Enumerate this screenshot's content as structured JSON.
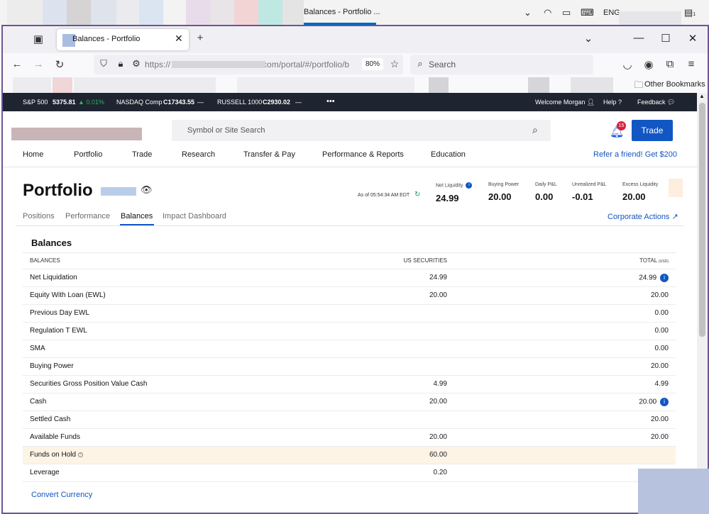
{
  "taskbar": {
    "title": "Balances - Portfolio ...",
    "tray_lang": "ENG",
    "notification_count": "1"
  },
  "browser": {
    "tab_title": "Balances - Portfolio",
    "url": "https://",
    "url_tail": "com/portal/#/portfolio/b",
    "zoom": "80%",
    "search_placeholder": "Search",
    "bookmarks_label": "Other Bookmarks"
  },
  "ticker": {
    "sp500_label": "S&P 500",
    "sp500_value": "5375.81",
    "sp500_change": "▲ 0.01%",
    "nasdaq_label": "NASDAQ Comp",
    "nasdaq_value": "C17343.55",
    "nasdaq_change": "—",
    "russell_label": "RUSSELL 1000",
    "russell_value": "C2930.02",
    "russell_change": "—",
    "more": "•••",
    "welcome": "Welcome Morgan",
    "help": "Help",
    "feedback": "Feedback"
  },
  "header": {
    "site_search_placeholder": "Symbol or Site Search",
    "notification_badge": "15",
    "trade_label": "Trade"
  },
  "mainnav": {
    "items": [
      "Home",
      "Portfolio",
      "Trade",
      "Research",
      "Transfer & Pay",
      "Performance & Reports",
      "Education"
    ],
    "refer": "Refer a friend! Get $200"
  },
  "portfolio": {
    "title": "Portfolio",
    "as_of": "As of 05:54:34 AM EDT",
    "metrics": [
      {
        "label": "Net Liquidity",
        "value": "24.99"
      },
      {
        "label": "Buying Power",
        "value": "20.00"
      },
      {
        "label": "Daily P&L",
        "value": "0.00"
      },
      {
        "label": "Unrealized P&L",
        "value": "-0.01"
      },
      {
        "label": "Excess Liquidity",
        "value": "20.00"
      }
    ],
    "subtabs": [
      "Positions",
      "Performance",
      "Balances",
      "Impact Dashboard"
    ],
    "corporate_actions": "Corporate Actions"
  },
  "balances": {
    "card_title": "Balances",
    "headers": {
      "label": "BALANCES",
      "us": "US SECURITIES",
      "total": "TOTAL",
      "total_unit": "(USD)"
    },
    "rows": [
      {
        "label": "Net Liquidation",
        "us": "24.99",
        "total": "24.99"
      },
      {
        "label": "Equity With Loan (EWL)",
        "us": "20.00",
        "total": "20.00"
      },
      {
        "label": "Previous Day EWL",
        "us": "",
        "total": "0.00"
      },
      {
        "label": "Regulation T EWL",
        "us": "",
        "total": "0.00"
      },
      {
        "label": "SMA",
        "us": "",
        "total": "0.00"
      },
      {
        "label": "Buying Power",
        "us": "",
        "total": "20.00"
      },
      {
        "label": "Securities Gross Position Value Cash",
        "us": "4.99",
        "total": "4.99"
      },
      {
        "label": "Cash",
        "us": "20.00",
        "total": "20.00"
      },
      {
        "label": "Settled Cash",
        "us": "",
        "total": "20.00"
      },
      {
        "label": "Available Funds",
        "us": "20.00",
        "total": "20.00"
      },
      {
        "label": "Funds on Hold",
        "us": "60.00",
        "total": ""
      },
      {
        "label": "Leverage",
        "us": "0.20",
        "total": ""
      }
    ],
    "convert_currency": "Convert Currency"
  },
  "colors": {
    "brand_blue": "#1256c4",
    "ticker_bg": "#1e2430",
    "highlight_row": "#fdf4e6",
    "window_border": "#6e5494"
  }
}
